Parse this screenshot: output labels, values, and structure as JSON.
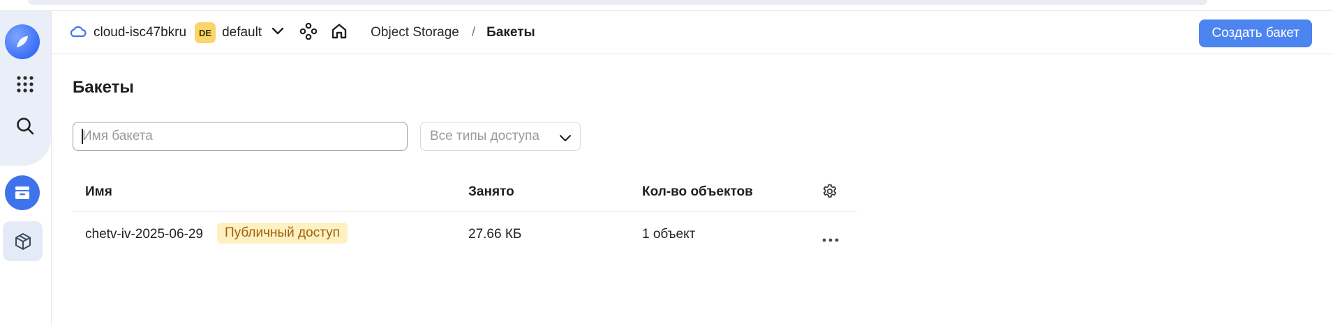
{
  "header": {
    "cloud_name": "cloud-isc47bkru",
    "folder_badge": "DE",
    "folder_name": "default",
    "breadcrumb": {
      "service": "Object Storage",
      "separator": "/",
      "current": "Бакеты"
    },
    "create_button": "Создать бакет"
  },
  "page": {
    "title": "Бакеты"
  },
  "filters": {
    "search_placeholder": "Имя бакета",
    "search_value": "",
    "access_select": "Все типы доступа"
  },
  "table": {
    "columns": {
      "name": "Имя",
      "used": "Занято",
      "objects": "Кол-во объектов"
    },
    "rows": [
      {
        "name": "chetv-iv-2025-06-29",
        "badge": "Публичный доступ",
        "used": "27.66 КБ",
        "objects": "1 объект"
      }
    ]
  },
  "colors": {
    "accent": "#4c84f0",
    "sidebar_active": "#3f73ec",
    "folder_badge": "#fbd46a",
    "public_badge_bg": "#fdf0c2",
    "public_badge_text": "#a0600a"
  },
  "icons": {
    "sidebar": [
      "logo-icon",
      "apps-grid-icon",
      "search-icon",
      "object-storage-icon",
      "cube-icon"
    ],
    "header": [
      "cloud-icon",
      "chevron-down-icon",
      "nodes-icon",
      "home-icon"
    ],
    "table": [
      "gear-icon",
      "more-icon"
    ]
  }
}
